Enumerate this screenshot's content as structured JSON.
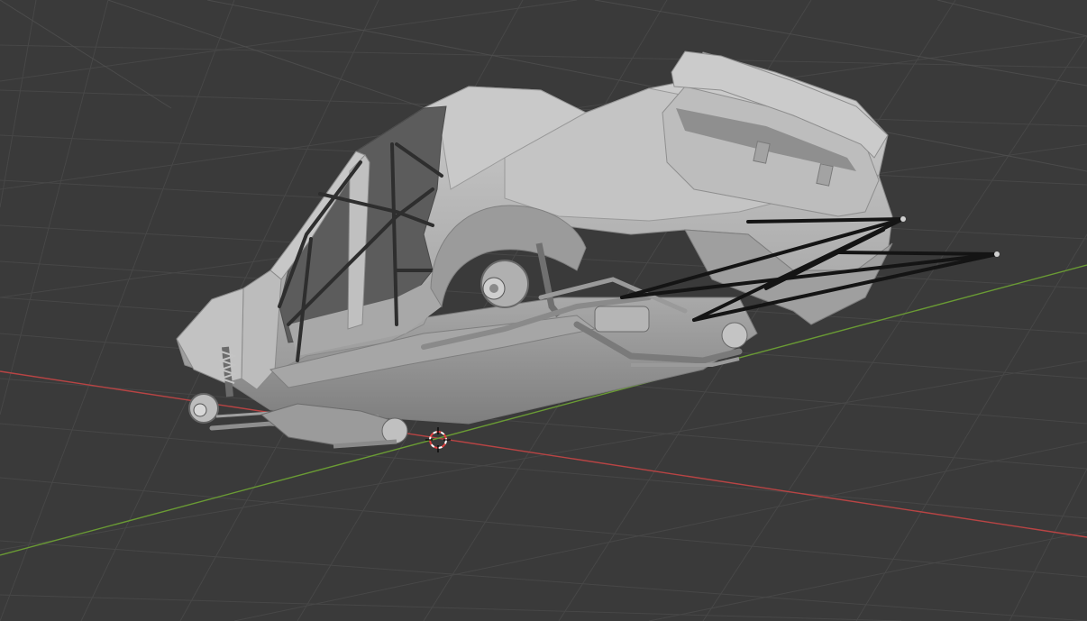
{
  "viewport": {
    "background_color": "#3a3a3a",
    "grid_color": "#4a4a4a",
    "grid_minor_color": "#424242",
    "axis_x_color": "#c24848",
    "axis_y_color": "#6fa03a",
    "model_body_color": "#b9b9b9",
    "model_shadow_color": "#8e8e8e",
    "model_dark_color": "#2a2a2a",
    "cursor_color": "#e04040",
    "objects": [
      "car-body-model",
      "roll-cage",
      "front-suspension",
      "rear-suspension",
      "brace-rods"
    ]
  },
  "cursor": {
    "icon": "3d-cursor-icon"
  }
}
